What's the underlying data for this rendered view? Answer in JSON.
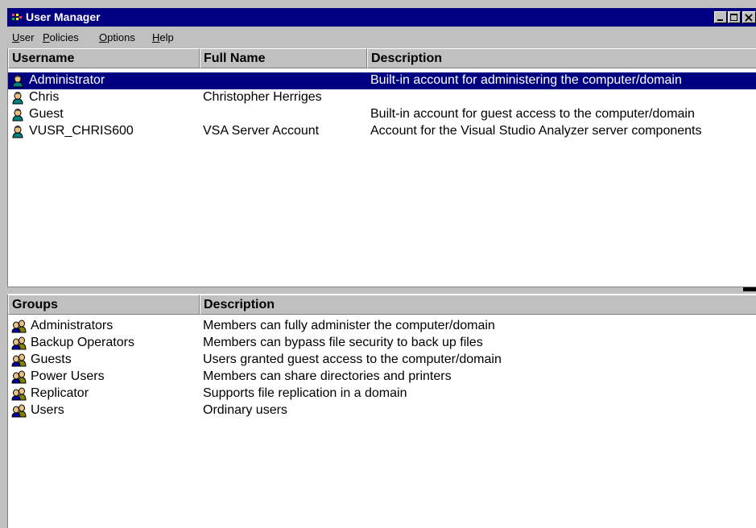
{
  "window": {
    "title": "User Manager"
  },
  "menu": [
    {
      "label": "User",
      "icon": "none"
    },
    {
      "label": "Policies"
    },
    {
      "label": "Options"
    },
    {
      "label": "Help"
    }
  ],
  "users": {
    "columns": [
      "Username",
      "Full Name",
      "Description"
    ],
    "rows": [
      {
        "username": "Administrator",
        "full_name": "",
        "description": "Built-in account for administering the computer/domain",
        "selected": true,
        "icon": "user-icon"
      },
      {
        "username": "Chris",
        "full_name": "Christopher Herriges",
        "description": "",
        "icon": "user-icon"
      },
      {
        "username": "Guest",
        "full_name": "",
        "description": "Built-in account for guest access to the computer/domain",
        "icon": "user-icon"
      },
      {
        "username": "VUSR_CHRIS600",
        "full_name": "VSA Server Account",
        "description": "Account for the Visual Studio Analyzer server components",
        "icon": "user-icon"
      }
    ]
  },
  "groups": {
    "columns": [
      "Groups",
      "Description"
    ],
    "rows": [
      {
        "name": "Administrators",
        "description": "Members can fully administer the computer/domain",
        "icon": "group-icon"
      },
      {
        "name": "Backup Operators",
        "description": "Members can bypass file security to back up files",
        "icon": "group-icon"
      },
      {
        "name": "Guests",
        "description": "Users granted guest access to the computer/domain",
        "icon": "group-icon"
      },
      {
        "name": "Power Users",
        "description": "Members can share directories and printers",
        "icon": "group-icon"
      },
      {
        "name": "Replicator",
        "description": "Supports file replication in a domain",
        "icon": "group-icon"
      },
      {
        "name": "Users",
        "description": "Ordinary users",
        "icon": "group-icon"
      }
    ]
  },
  "colors": {
    "title_bar": "#000080",
    "selection": "#000080",
    "chrome": "#c0c0c0"
  }
}
